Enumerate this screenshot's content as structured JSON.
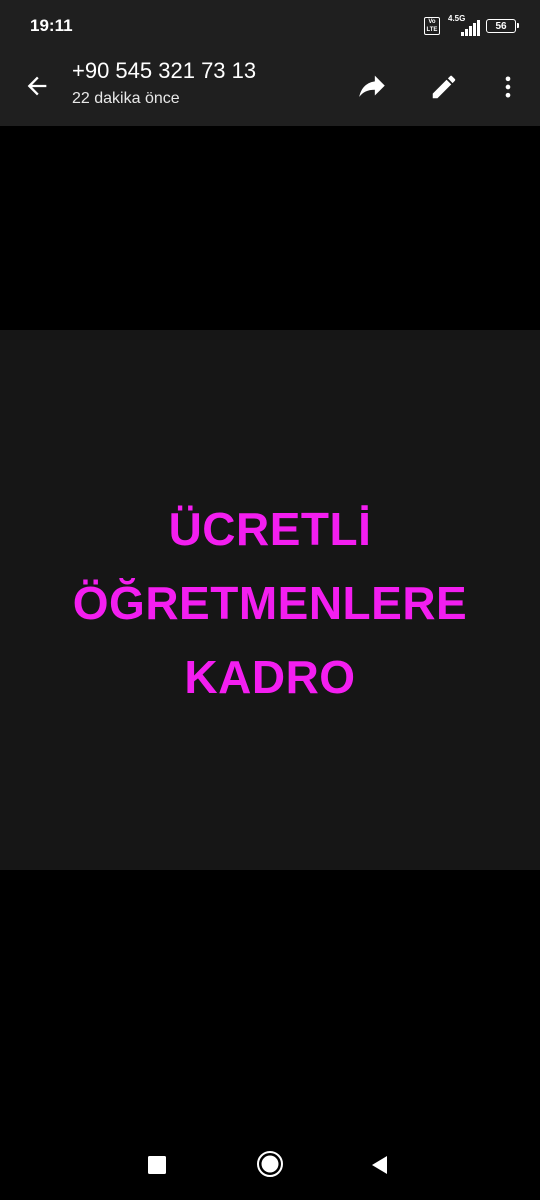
{
  "status_bar": {
    "time": "19:11",
    "volte_label": "Vo LTE",
    "network_type": "4.5G",
    "battery_level": "56",
    "icons": [
      "volte-icon",
      "signal-icon",
      "battery-icon"
    ]
  },
  "header": {
    "title": "+90 545 321 73 13",
    "subtitle": "22 dakika önce",
    "icons": [
      "back-arrow-icon",
      "forward-icon",
      "edit-pencil-icon",
      "more-vert-icon"
    ]
  },
  "media": {
    "lines": [
      "ÜCRETLİ",
      "ÖĞRETMENLERE",
      "KADRO"
    ],
    "text_color": "#f31ef0",
    "background_color": "#161616"
  },
  "nav_bar": {
    "icons": [
      "recent-apps-icon",
      "home-icon",
      "back-triangle-icon"
    ]
  },
  "colors": {
    "app_bar": "#1f1f1f",
    "background": "#000000",
    "icon": "#ffffff"
  }
}
